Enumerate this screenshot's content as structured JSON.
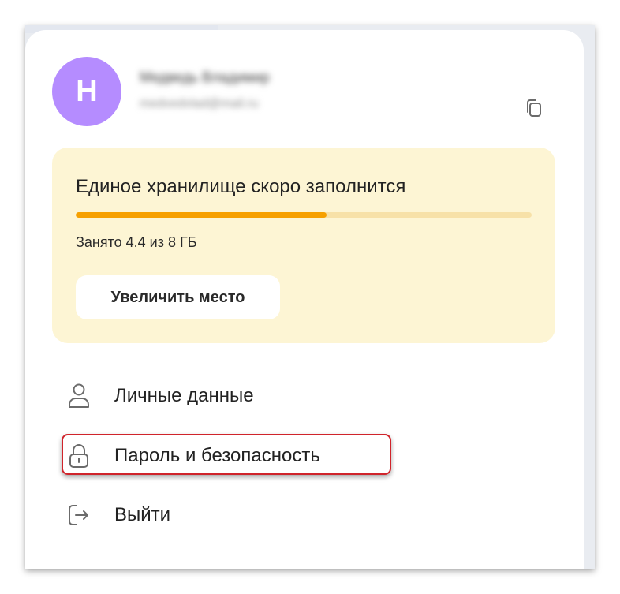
{
  "account": {
    "avatar_letter": "Н",
    "avatar_color": "#b58cff",
    "user_name": "Медведь Владимир",
    "user_email": "medvedvlad@mail.ru",
    "copy_icon": "copy-icon"
  },
  "storage": {
    "title": "Единое хранилище скоро заполнится",
    "used_label": "Занято 4.4 из 8 ГБ",
    "used_fraction": 0.55,
    "action_label": "Увеличить место",
    "card_color": "#fdf5d4",
    "bar_color": "#f6a000",
    "bar_track_color": "#f7e1a8"
  },
  "menu": {
    "items": [
      {
        "label": "Личные данные",
        "icon": "user-icon"
      },
      {
        "label": "Пароль и безопасность",
        "icon": "lock-icon",
        "highlighted": true
      },
      {
        "label": "Выйти",
        "icon": "logout-icon"
      }
    ]
  },
  "highlight_color": "#d0242b"
}
